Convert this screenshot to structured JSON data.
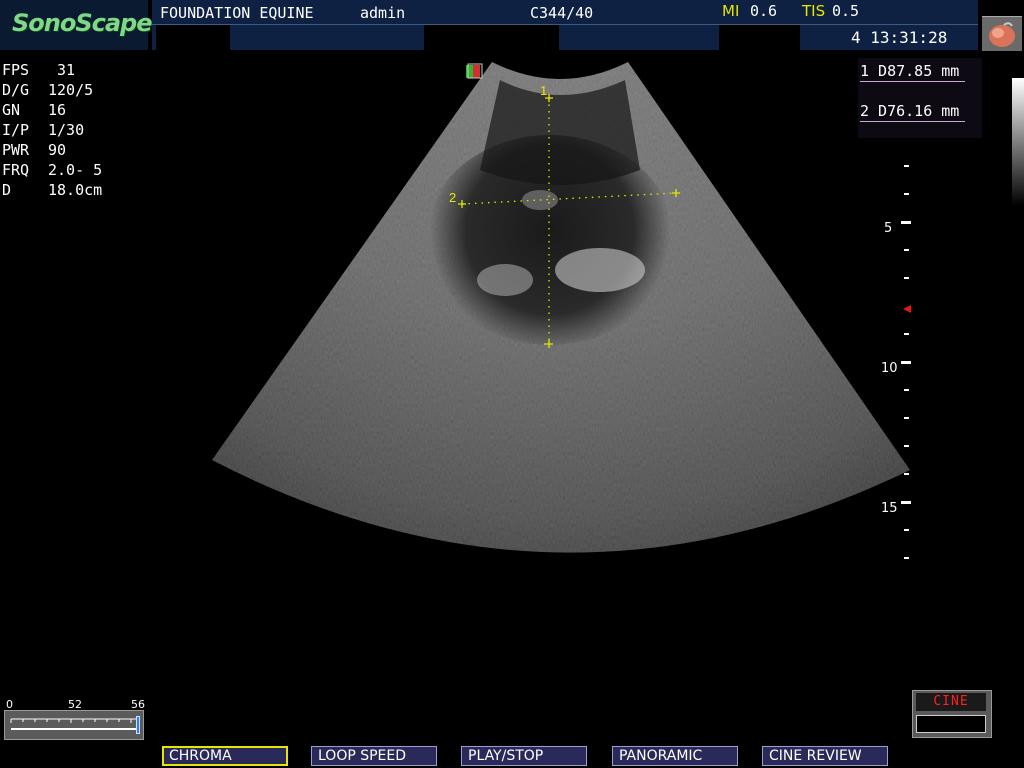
{
  "header": {
    "brand": "SonoScape",
    "institution": "FOUNDATION EQUINE",
    "user": "admin",
    "probe": "C344/40",
    "mi_label": "MI",
    "mi_value": "0.6",
    "tis_label": "TIS",
    "tis_value": "0.5",
    "clock": "4 13:31:28"
  },
  "params": [
    {
      "key": "FPS",
      "value": " 31"
    },
    {
      "key": "D/G",
      "value": "120/5"
    },
    {
      "key": "GN",
      "value": "16"
    },
    {
      "key": "I/P",
      "value": "1/30"
    },
    {
      "key": "PWR",
      "value": "90"
    },
    {
      "key": "FRQ",
      "value": "2.0- 5"
    },
    {
      "key": "D",
      "value": "18.0cm"
    }
  ],
  "measurements": [
    {
      "label": "1 D87.85 mm"
    },
    {
      "label": "2 D76.16 mm"
    }
  ],
  "caliper_labels": [
    "1",
    "2"
  ],
  "depth_scale": [
    "5",
    "10",
    "15"
  ],
  "slider": {
    "min": "0",
    "mid": "52",
    "max": "56",
    "value": 52,
    "range": 56
  },
  "cine": {
    "label": "CINE"
  },
  "softkeys": [
    {
      "label": "CHROMA",
      "active": true
    },
    {
      "label": "LOOP SPEED",
      "active": false
    },
    {
      "label": "PLAY/STOP",
      "active": false
    },
    {
      "label": "PANORAMIC",
      "active": false
    },
    {
      "label": "CINE REVIEW",
      "active": false
    }
  ],
  "colors": {
    "caliper": "#e6e600",
    "header_bg": "#0e2142",
    "brand": "#7fd88a",
    "softkey_bg": "#2a2a5a",
    "active_border": "#e6e600"
  }
}
